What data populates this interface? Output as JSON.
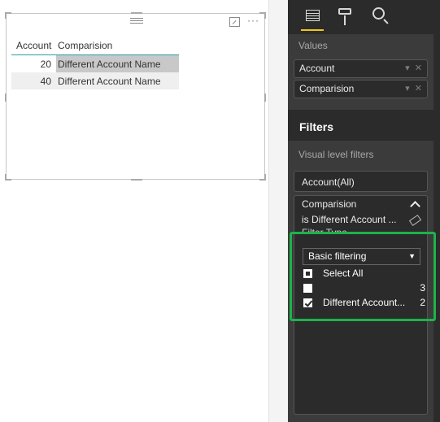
{
  "visual": {
    "table": {
      "headers": [
        "Account",
        "Comparision"
      ],
      "rows": [
        [
          "20",
          "Different Account Name"
        ],
        [
          "40",
          "Different Account Name"
        ]
      ]
    },
    "icons": {
      "focus": "focus-mode-icon",
      "more": "more-options-icon",
      "more_glyph": "···"
    }
  },
  "pane": {
    "tabs": [
      "fields-icon",
      "format-roller-icon",
      "analytics-icon"
    ],
    "values_label": "Values",
    "value_fields": [
      {
        "label": "Account"
      },
      {
        "label": "Comparision"
      }
    ],
    "field_controls": {
      "dropdown": "▾",
      "remove": "✕"
    },
    "filters_title": "Filters",
    "visual_level_label": "Visual level filters",
    "account_filter": "Account(All)",
    "comparision_filter": {
      "title": "Comparision",
      "summary": "is Different Account ...",
      "filter_type_label": "Filter Type",
      "filter_type_value": "Basic filtering",
      "options": [
        {
          "label": "Select All",
          "count": "",
          "state": "partial"
        },
        {
          "label": "",
          "count": "3",
          "state": "unchecked"
        },
        {
          "label": "Different Account...",
          "count": "2",
          "state": "checked"
        }
      ]
    }
  },
  "colors": {
    "pane_bg": "#2b2b2b",
    "well_bg": "#3b3b3b",
    "accent_yellow": "#f2c811",
    "header_underline": "#22a3a0",
    "highlight_green": "#1db34a"
  }
}
